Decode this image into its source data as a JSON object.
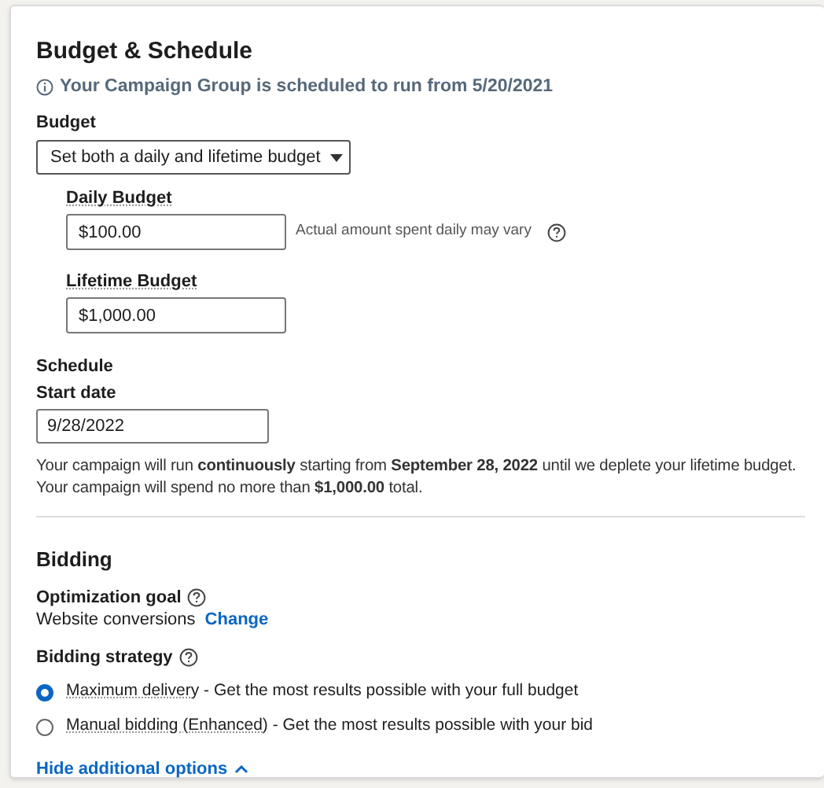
{
  "budget_schedule": {
    "title": "Budget & Schedule",
    "notice": "Your Campaign Group is scheduled to run from 5/20/2021",
    "budget_label": "Budget",
    "budget_dropdown": "Set both a daily and lifetime budget",
    "daily": {
      "label": "Daily Budget",
      "value": "$100.00",
      "hint": "Actual amount spent daily may vary"
    },
    "lifetime": {
      "label": "Lifetime Budget",
      "value": "$1,000.00"
    },
    "schedule_label": "Schedule",
    "start_label": "Start date",
    "start_value": "9/28/2022",
    "summary": [
      "Your campaign will run **continuously** starting from **September 28, 2022** until we deplete your lifetime budget.",
      "Your campaign will spend no more than **$1,000.00** total."
    ]
  },
  "bidding": {
    "title": "Bidding",
    "goal_label": "Optimization goal",
    "goal_value": "Website conversions",
    "goal_link": "Change",
    "strategy_label": "Bidding strategy",
    "options": [
      {
        "term": "Maximum delivery",
        "text": " - Get the most results possible with your full budget",
        "selected": true
      },
      {
        "term": "Manual bidding (Enhanced)",
        "text": " - Get the most results possible with your bid",
        "selected": false
      }
    ],
    "toggle": "Hide additional options"
  }
}
